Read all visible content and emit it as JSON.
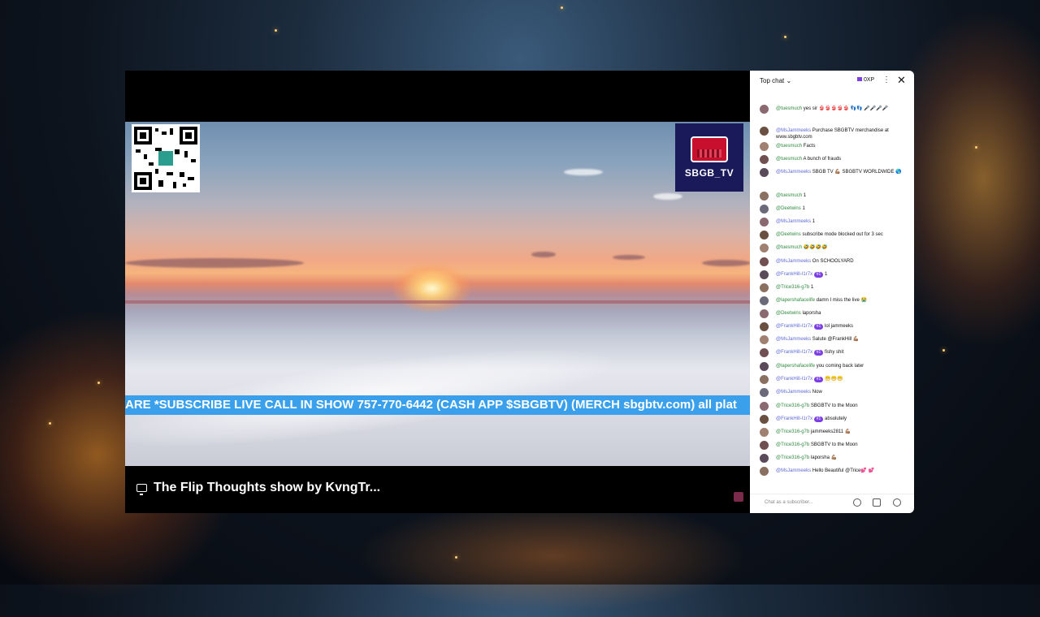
{
  "video": {
    "ticker_text": "ARE *SUBSCRIBE LIVE CALL IN SHOW 757-770-6442 (CASH APP $SBGBTV) (MERCH sbgbtv.com) all plat",
    "logo_text": "SBGB_TV",
    "caption_title": "The Flip Thoughts show by KvngTr..."
  },
  "chat": {
    "header_label": "Top chat",
    "points_label": "0XP",
    "input_placeholder": "Chat as a subscriber...",
    "messages": [
      {
        "name": "@tuesmuch",
        "text": "yes sir 👙👙👙👙👙 👣👣 🎤🎤🎤🎤",
        "mod": false
      },
      {
        "name": "@MsJammeeks",
        "text": "Purchase SBGBTV merchandise at www.sbgbtv.com",
        "mod": true
      },
      {
        "name": "@tuesmuch",
        "text": "Facts",
        "mod": false
      },
      {
        "name": "@tuesmuch",
        "text": "A bunch of frauds",
        "mod": false
      },
      {
        "name": "@MsJammeeks",
        "text": "SBGB TV 💪🏽 SBGBTV WORLDWIDE 🌎",
        "mod": true
      },
      {
        "name": "@tuesmuch",
        "text": "1",
        "mod": false
      },
      {
        "name": "@Deetwins",
        "text": "1",
        "mod": false
      },
      {
        "name": "@MsJammeeks",
        "text": "1",
        "mod": true
      },
      {
        "name": "@Deetwins",
        "text": "subscribe mode blocked out for 3 sec",
        "mod": false
      },
      {
        "name": "@tuesmuch",
        "text": "🤣🤣🤣🤣",
        "mod": false
      },
      {
        "name": "@MsJammeeks",
        "text": "On SCHOOLYARD",
        "mod": true
      },
      {
        "name": "@FrankHill-I1r7x",
        "text": "1",
        "mod": true,
        "badge": "#1"
      },
      {
        "name": "@Trice316-g7b",
        "text": "1",
        "mod": false
      },
      {
        "name": "@lapershafacelife",
        "text": "damn I miss the live 😭",
        "mod": false
      },
      {
        "name": "@Deetwins",
        "text": "laporsha",
        "mod": false
      },
      {
        "name": "@FrankHill-I1r7x",
        "text": "lol jammeeks",
        "mod": true,
        "badge": "#1"
      },
      {
        "name": "@MsJammeeks",
        "text": "Salute @FrankHill 💪🏽",
        "mod": true
      },
      {
        "name": "@FrankHill-I1r7x",
        "text": "fishy shit",
        "mod": true,
        "badge": "#1"
      },
      {
        "name": "@lapershafacelife",
        "text": "you coming back later",
        "mod": false
      },
      {
        "name": "@FrankHill-I1r7x",
        "text": "😁😁😁",
        "mod": true,
        "badge": "#1"
      },
      {
        "name": "@MsJammeeks",
        "text": "Now",
        "mod": true
      },
      {
        "name": "@Trice316-g7b",
        "text": "SBGBTV to the Moon",
        "mod": false
      },
      {
        "name": "@FrankHill-I1r7x",
        "text": "absolutely",
        "mod": true,
        "badge": "#1"
      },
      {
        "name": "@Trice316-g7b",
        "text": "jammeeks2811 💪🏽",
        "mod": false
      },
      {
        "name": "@Trice316-g7b",
        "text": "SBGBTV to the Moon",
        "mod": false
      },
      {
        "name": "@Trice316-g7b",
        "text": "laporsha 💪🏽",
        "mod": false
      },
      {
        "name": "@MsJammeeks",
        "text": "Hello Beautiful @Trice💕 💕",
        "mod": true
      }
    ]
  }
}
